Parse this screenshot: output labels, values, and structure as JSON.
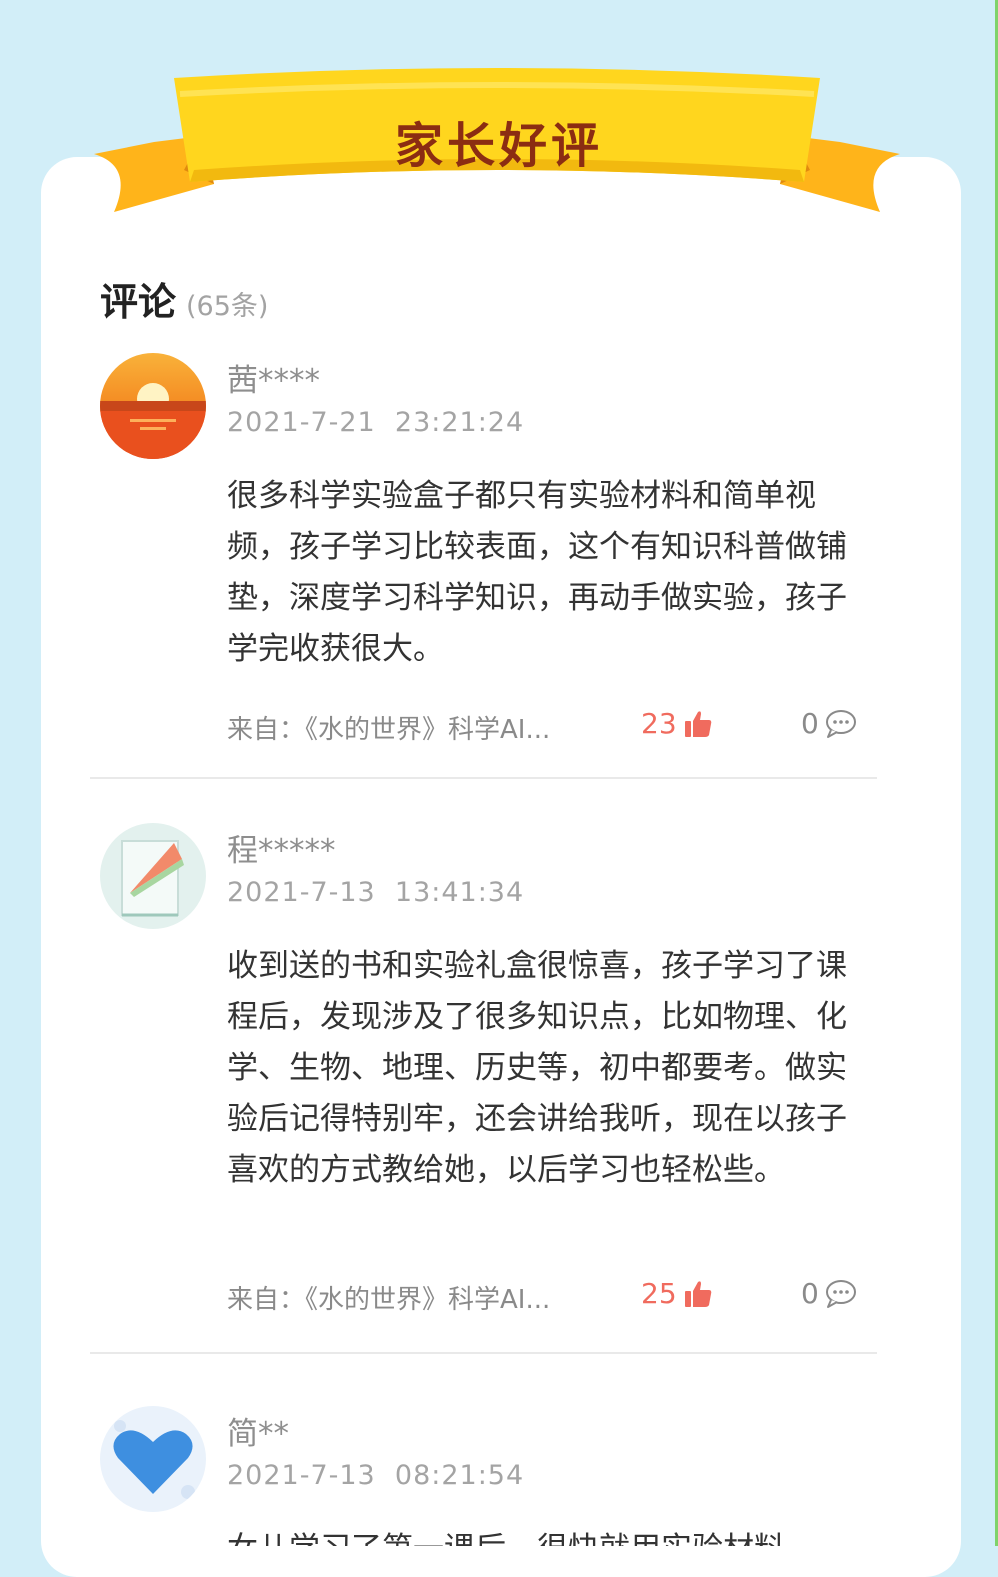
{
  "header": {
    "banner_title": "家长好评"
  },
  "section": {
    "title": "评论",
    "count": "(65条)"
  },
  "comments": [
    {
      "user": "茜****",
      "time": "2021-7-21  23:21:24",
      "text": "很多科学实验盒子都只有实验材料和简单视频，孩子学习比较表面，这个有知识科普做铺垫，深度学习科学知识，再动手做实验，孩子学完收获很大。",
      "source": "来自：《水的世界》科学AI...",
      "likes": "23",
      "replies": "0"
    },
    {
      "user": "程*****",
      "time": "2021-7-13  13:41:34",
      "text": "收到送的书和实验礼盒很惊喜，孩子学习了课程后，发现涉及了很多知识点，比如物理、化学、生物、地理、历史等，初中都要考。做实验后记得特别牢，还会讲给我听，现在以孩子喜欢的方式教给她，以后学习也轻松些。",
      "source": "来自：《水的世界》科学AI...",
      "likes": "25",
      "replies": "0"
    },
    {
      "user": "简**",
      "time": "2021-7-13  08:21:54",
      "text": "女儿学习了第一课后，很快就用实验材料"
    }
  ],
  "colors": {
    "background": "#d2eef8",
    "banner": "#ffd21f",
    "like": "#f06b5e"
  },
  "icons": [
    "thumbs-up-icon",
    "comment-bubble-icon"
  ]
}
